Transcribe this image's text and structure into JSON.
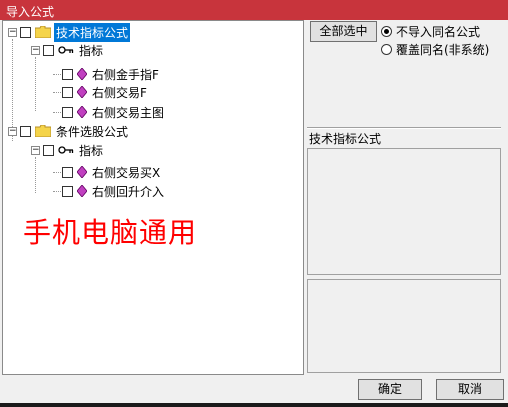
{
  "window": {
    "title": "导入公式"
  },
  "tree": {
    "nodes": [
      {
        "label": "技术指标公式",
        "type": "folder",
        "expander": "−"
      },
      {
        "label": "指标",
        "type": "key",
        "expander": "−"
      },
      {
        "label": "右侧金手指F",
        "type": "item"
      },
      {
        "label": "右侧交易F",
        "type": "item"
      },
      {
        "label": "右侧交易主图",
        "type": "item"
      },
      {
        "label": "条件选股公式",
        "type": "folder",
        "expander": "−"
      },
      {
        "label": "指标",
        "type": "key",
        "expander": "−"
      },
      {
        "label": "右侧交易买X",
        "type": "item"
      },
      {
        "label": "右侧回升介入",
        "type": "item"
      }
    ]
  },
  "overlay_text": "手机电脑通用",
  "right": {
    "select_all_label": "全部选中",
    "radio_options": [
      {
        "label": "不导入同名公式",
        "checked": true
      },
      {
        "label": "覆盖同名(非系统)",
        "checked": false
      }
    ],
    "section_label": "技术指标公式"
  },
  "footer": {
    "ok_label": "确定",
    "cancel_label": "取消"
  },
  "colors": {
    "title_bar": "#c8343c",
    "selection": "#0078d7",
    "overlay_text": "#ff0000"
  }
}
